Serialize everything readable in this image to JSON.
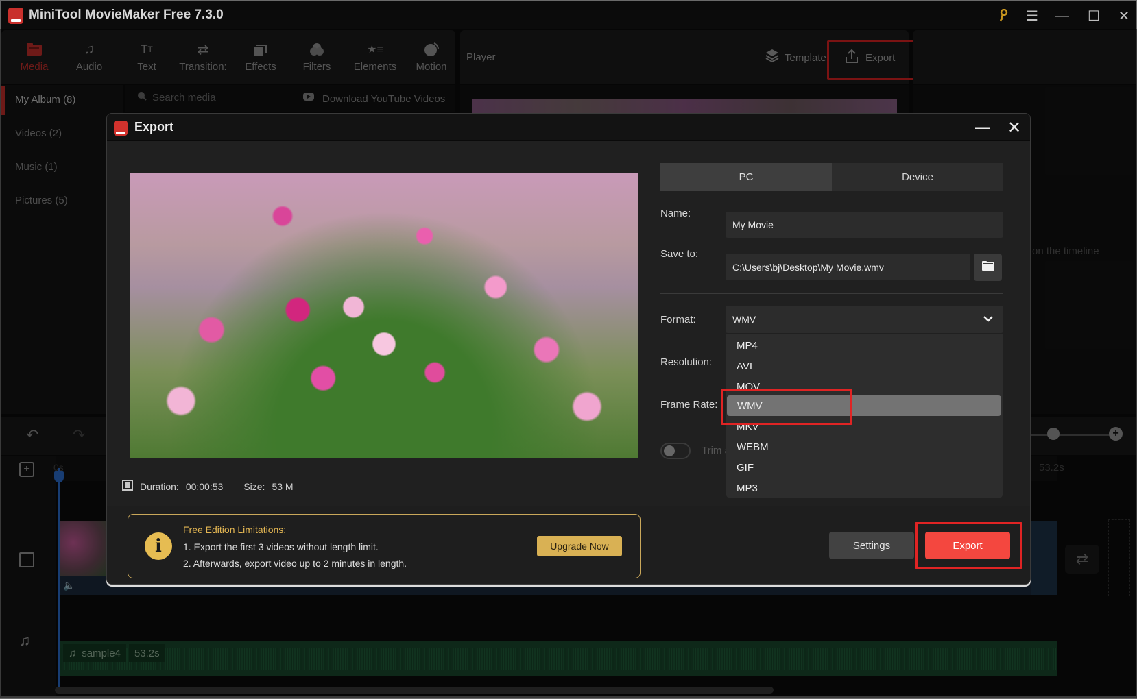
{
  "app": {
    "title": "MiniTool MovieMaker Free 7.3.0",
    "window_controls": {
      "key": "key-icon",
      "menu": "☰",
      "minimize": "—",
      "maximize": "☐",
      "close": "✕"
    }
  },
  "toolbar": {
    "items": [
      {
        "label": "Media",
        "active": true
      },
      {
        "label": "Audio"
      },
      {
        "label": "Text"
      },
      {
        "label": "Transition:"
      },
      {
        "label": "Effects"
      },
      {
        "label": "Filters"
      },
      {
        "label": "Elements"
      },
      {
        "label": "Motion"
      }
    ]
  },
  "player": {
    "label": "Player",
    "template_label": "Template",
    "export_label": "Export",
    "hint": "on the timeline"
  },
  "media": {
    "albums": [
      "My Album (8)",
      "Videos (2)",
      "Music (1)",
      "Pictures (5)"
    ],
    "search_placeholder": "Search media",
    "youtube_label": "Download YouTube Videos"
  },
  "timeline": {
    "start_label": "0s",
    "end_label": "53.2s",
    "zoom_level": 0.25,
    "audio_clip": {
      "name": "sample4",
      "duration": "53.2s"
    }
  },
  "export_dialog": {
    "title": "Export",
    "tabs": [
      {
        "label": "PC",
        "active": true
      },
      {
        "label": "Device"
      }
    ],
    "name_label": "Name:",
    "name_value": "My Movie",
    "save_label": "Save to:",
    "save_value": "C:\\Users\\bj\\Desktop\\My Movie.wmv",
    "format_label": "Format:",
    "format_value": "WMV",
    "resolution_label": "Resolution:",
    "frame_rate_label": "Frame Rate:",
    "trim_label": "Trim a",
    "trim_enabled": false,
    "format_options": [
      "MP4",
      "AVI",
      "MOV",
      "WMV",
      "MKV",
      "WEBM",
      "GIF",
      "MP3"
    ],
    "selected_format": "WMV",
    "duration_label": "Duration:",
    "duration_value": "00:00:53",
    "size_label": "Size:",
    "size_value": "53 M",
    "limitations": {
      "title": "Free Edition Limitations:",
      "line1": "1. Export the first 3 videos without length limit.",
      "line2": "2. Afterwards, export video up to 2 minutes in length.",
      "upgrade_label": "Upgrade Now"
    },
    "settings_label": "Settings",
    "export_label": "Export"
  },
  "colors": {
    "accent_red": "#c9302c",
    "export_button": "#f4473f",
    "highlight_box": "#e02424",
    "upgrade_gold": "#d9b154",
    "playhead_blue": "#2c6fd1",
    "audio_green": "#1a4a2e"
  }
}
